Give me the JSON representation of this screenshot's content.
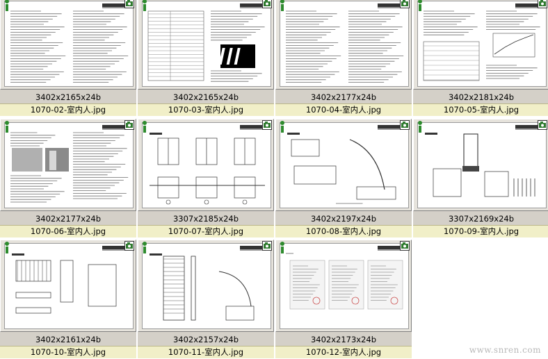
{
  "thumbnails": [
    {
      "dims": "",
      "name": "",
      "style": "text"
    },
    {
      "dims": "",
      "name": "",
      "style": "text"
    },
    {
      "dims": "",
      "name": "",
      "style": "text"
    },
    {
      "dims": "",
      "name": "",
      "style": "text"
    },
    {
      "dims": "3402x2165x24b",
      "name": "1070-02-室内人.jpg",
      "style": "text"
    },
    {
      "dims": "3402x2165x24b",
      "name": "1070-03-室内人.jpg",
      "style": "table"
    },
    {
      "dims": "3402x2177x24b",
      "name": "1070-04-室内人.jpg",
      "style": "text"
    },
    {
      "dims": "3402x2181x24b",
      "name": "1070-05-室内人.jpg",
      "style": "charts"
    },
    {
      "dims": "3402x2177x24b",
      "name": "1070-06-室内人.jpg",
      "style": "photos"
    },
    {
      "dims": "3307x2185x24b",
      "name": "1070-07-室内人.jpg",
      "style": "drawing"
    },
    {
      "dims": "3402x2197x24b",
      "name": "1070-08-室内人.jpg",
      "style": "drawing2"
    },
    {
      "dims": "3307x2169x24b",
      "name": "1070-09-室内人.jpg",
      "style": "drawing3"
    },
    {
      "dims": "3402x2161x24b",
      "name": "1070-10-室内人.jpg",
      "style": "drawing4"
    },
    {
      "dims": "3402x2157x24b",
      "name": "1070-11-室内人.jpg",
      "style": "drawing5"
    },
    {
      "dims": "3402x2173x24b",
      "name": "1070-12-室内人.jpg",
      "style": "certs"
    }
  ],
  "watermark": "www.snren.com",
  "colors": {
    "label_bg": "#f1efc8",
    "panel": "#d4d0c8",
    "info_icon": "#2e8b2e"
  }
}
